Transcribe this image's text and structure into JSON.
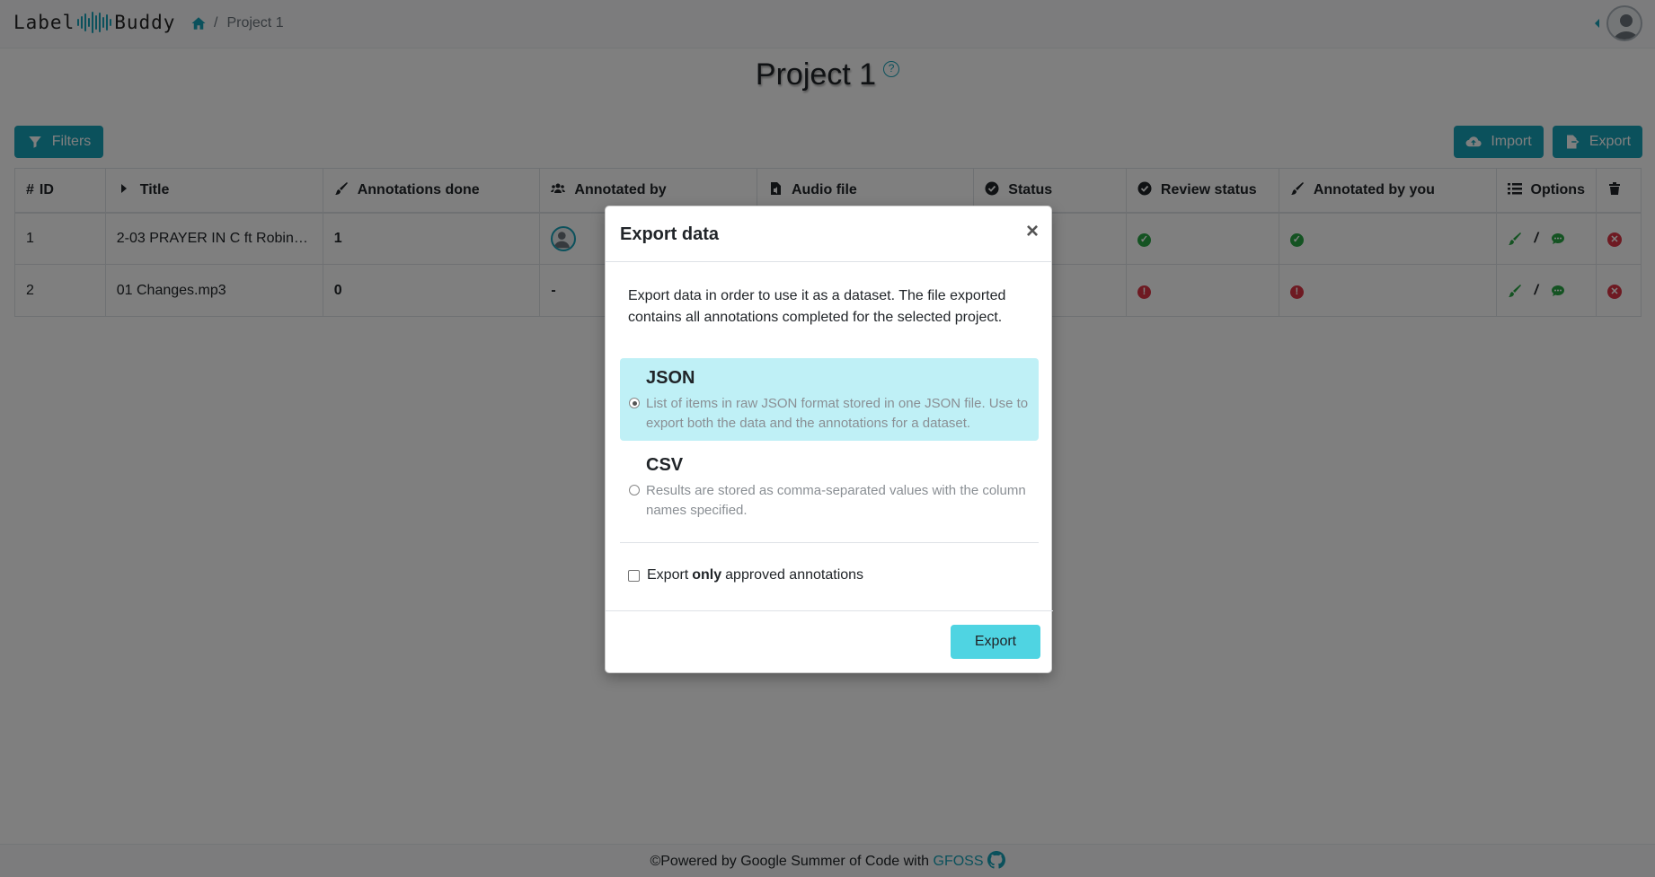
{
  "app": {
    "logo_left": "Label",
    "logo_right": "Buddy"
  },
  "breadcrumb": {
    "current": "Project 1"
  },
  "page": {
    "title": "Project 1",
    "help_glyph": "?"
  },
  "toolbar": {
    "filters": "Filters",
    "import": "Import",
    "export": "Export"
  },
  "table": {
    "columns": [
      "ID",
      "Title",
      "Annotations done",
      "Annotated by",
      "Audio file",
      "Status",
      "Review status",
      "Annotated by you",
      "Options"
    ],
    "id_prefix": "#",
    "rows": [
      {
        "id": "1",
        "title": "2-03 PRAYER IN C ft Robin…",
        "annotations_done": "1",
        "annotated_by": "avatar",
        "review_status": "approved",
        "annotated_by_you": "yes"
      },
      {
        "id": "2",
        "title": "01 Changes.mp3",
        "annotations_done": "0",
        "annotated_by": "-",
        "review_status": "not-reviewed",
        "annotated_by_you": "no"
      }
    ],
    "options_separator": "/"
  },
  "footer": {
    "text": "©Powered by Google Summer of Code with ",
    "link": "GFOSS"
  },
  "modal": {
    "title": "Export data",
    "close": "×",
    "description": "Export data in order to use it as a dataset. The file exported contains all annotations completed for the selected project.",
    "options": [
      {
        "name": "JSON",
        "description": "List of items in raw JSON format stored in one JSON file. Use to export both the data and the annotations for a dataset.",
        "selected": true
      },
      {
        "name": "CSV",
        "description": "Results are stored as comma-separated values with the column names specified.",
        "selected": false
      }
    ],
    "approved_prefix": "Export",
    "approved_bold": "only",
    "approved_suffix": "approved annotations",
    "export_button": "Export"
  },
  "colors": {
    "accent": "#17a2b8",
    "success": "#28a745",
    "danger": "#dc3545",
    "modal_button": "#4fd4e2",
    "selected_option": "#bff0f6"
  }
}
